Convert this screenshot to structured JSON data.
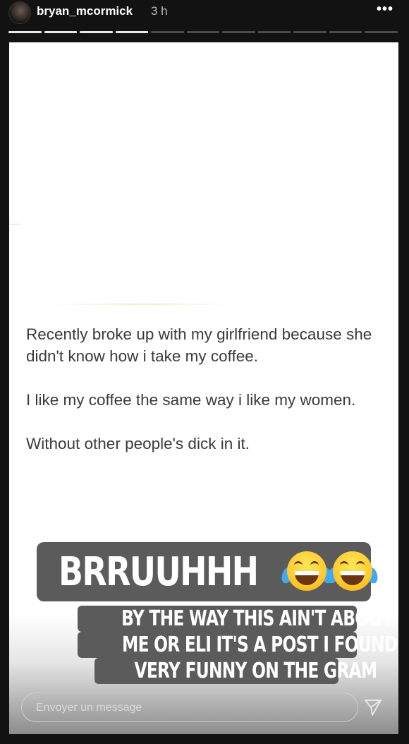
{
  "header": {
    "username": "bryan_mcormick",
    "time": "3 h",
    "more_icon": "more-icon"
  },
  "progress": {
    "total_segments": 11,
    "completed_segments": 4
  },
  "post": {
    "line1": "Recently broke up with my girlfriend because she didn't know how i take my coffee.",
    "line2": "I like my coffee the same way i like my women.",
    "line3": "Without other people's dick in it."
  },
  "stickers": {
    "big": "BRRUUHHH",
    "big_emoji": "face-with-tears-of-joy-icon",
    "small_line1": "BY THE WAY THIS AIN'T ABOUT",
    "small_line2": "ME OR ELI IT'S A POST I FOUND",
    "small_line3": "VERY FUNNY ON THE GRAM"
  },
  "reply": {
    "placeholder": "Envoyer un message",
    "send_icon": "send-icon"
  }
}
